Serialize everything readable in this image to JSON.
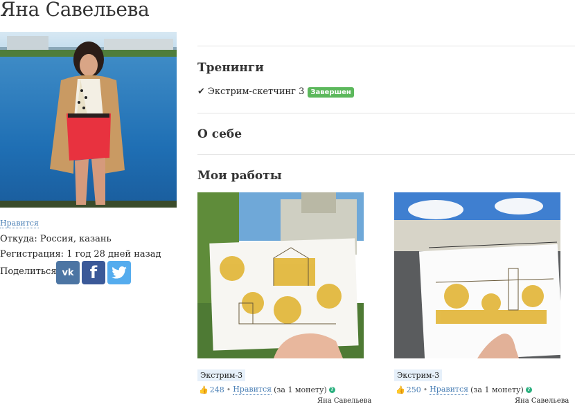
{
  "profile": {
    "name": "Яна Савельева",
    "like_link": "Нравится",
    "location": "Откуда: Россия, казань",
    "registered": "Регистрация: 1 год 28 дней назад",
    "share_label": "Поделиться",
    "social": [
      {
        "icon": "vk-icon",
        "label": "vk"
      },
      {
        "icon": "facebook-icon",
        "label": "f"
      },
      {
        "icon": "twitter-icon",
        "label": ""
      }
    ]
  },
  "sections": {
    "trainings_title": "Тренинги",
    "about_title": "О себе",
    "works_title": "Мои работы"
  },
  "trainings": [
    {
      "name": "Экстрим-скетчинг 3",
      "status": "Завершен"
    }
  ],
  "works": [
    {
      "tag": "Экстрим-3",
      "likes": "248",
      "like_link": "Нравится",
      "cost": "(за 1 монету)",
      "author": "Яна Савельева"
    },
    {
      "tag": "Экстрим-3",
      "likes": "250",
      "like_link": "Нравится",
      "cost": "(за 1 монету)",
      "author": "Яна Савельева"
    }
  ],
  "colors": {
    "accent_link": "#4a7fb5",
    "badge_green": "#5cb85c",
    "vk": "#4c75a3",
    "facebook": "#3b5998",
    "twitter": "#55acee",
    "tag_bg": "#e6f0fa"
  }
}
